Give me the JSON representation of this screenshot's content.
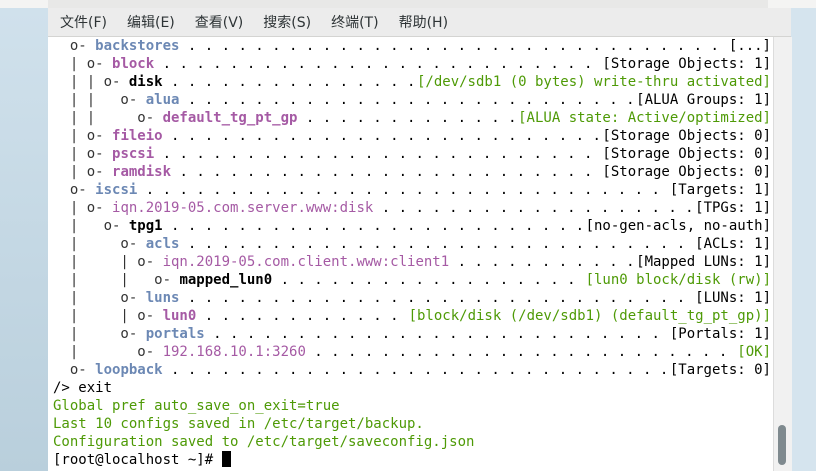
{
  "menubar": [
    {
      "label": "文件(F)"
    },
    {
      "label": "编辑(E)"
    },
    {
      "label": "查看(V)"
    },
    {
      "label": "搜索(S)"
    },
    {
      "label": "终端(T)"
    },
    {
      "label": "帮助(H)"
    }
  ],
  "tree": [
    {
      "prefix": "  o- ",
      "name": "backstores",
      "style": "dir",
      "status": "[...]",
      "status_style": "plain"
    },
    {
      "prefix": "  | o- ",
      "name": "block",
      "style": "obj",
      "status": "[Storage Objects: 1]",
      "status_style": "plain"
    },
    {
      "prefix": "  | | o- ",
      "name": "disk",
      "style": "plain",
      "status": "[/dev/sdb1 (0 bytes) write-thru activated]",
      "status_style": "green"
    },
    {
      "prefix": "  | |   o- ",
      "name": "alua",
      "style": "dir",
      "status": "[ALUA Groups: 1]",
      "status_style": "plain"
    },
    {
      "prefix": "  | |     o- ",
      "name": "default_tg_pt_gp",
      "style": "obj",
      "status": "[ALUA state: Active/optimized]",
      "status_style": "green"
    },
    {
      "prefix": "  | o- ",
      "name": "fileio",
      "style": "obj",
      "status": "[Storage Objects: 0]",
      "status_style": "plain"
    },
    {
      "prefix": "  | o- ",
      "name": "pscsi",
      "style": "obj",
      "status": "[Storage Objects: 0]",
      "status_style": "plain"
    },
    {
      "prefix": "  | o- ",
      "name": "ramdisk",
      "style": "obj",
      "status": "[Storage Objects: 0]",
      "status_style": "plain"
    },
    {
      "prefix": "  o- ",
      "name": "iscsi",
      "style": "dir",
      "status": "[Targets: 1]",
      "status_style": "plain"
    },
    {
      "prefix": "  | o- ",
      "name": "iqn.2019-05.com.server.www:disk",
      "style": "iqn",
      "status": "[TPGs: 1]",
      "status_style": "plain"
    },
    {
      "prefix": "  |   o- ",
      "name": "tpg1",
      "style": "plain",
      "status": "[no-gen-acls, no-auth]",
      "status_style": "plain"
    },
    {
      "prefix": "  |     o- ",
      "name": "acls",
      "style": "dir",
      "status": "[ACLs: 1]",
      "status_style": "plain"
    },
    {
      "prefix": "  |     | o- ",
      "name": "iqn.2019-05.com.client.www:client1",
      "style": "iqn",
      "status": "[Mapped LUNs: 1]",
      "status_style": "plain"
    },
    {
      "prefix": "  |     |   o- ",
      "name": "mapped_lun0",
      "style": "plain",
      "status": "[lun0 block/disk (rw)]",
      "status_style": "green"
    },
    {
      "prefix": "  |     o- ",
      "name": "luns",
      "style": "dir",
      "status": "[LUNs: 1]",
      "status_style": "plain"
    },
    {
      "prefix": "  |     | o- ",
      "name": "lun0",
      "style": "obj",
      "status": "[block/disk (/dev/sdb1) (default_tg_pt_gp)]",
      "status_style": "green"
    },
    {
      "prefix": "  |     o- ",
      "name": "portals",
      "style": "dir",
      "status": "[Portals: 1]",
      "status_style": "plain"
    },
    {
      "prefix": "  |       o- ",
      "name": "192.168.10.1:3260",
      "style": "iqn",
      "status": "[OK]",
      "status_style": "green"
    },
    {
      "prefix": "  o- ",
      "name": "loopback",
      "style": "dir",
      "status": "[Targets: 0]",
      "status_style": "plain"
    }
  ],
  "output": [
    {
      "text": "/> exit",
      "style": "plain"
    },
    {
      "text": "Global pref auto_save_on_exit=true",
      "style": "green"
    },
    {
      "text": "Last 10 configs saved in /etc/target/backup.",
      "style": "green"
    },
    {
      "text": "Configuration saved to /etc/target/saveconfig.json",
      "style": "green"
    }
  ],
  "prompt": {
    "text": "[root@localhost ~]# "
  }
}
